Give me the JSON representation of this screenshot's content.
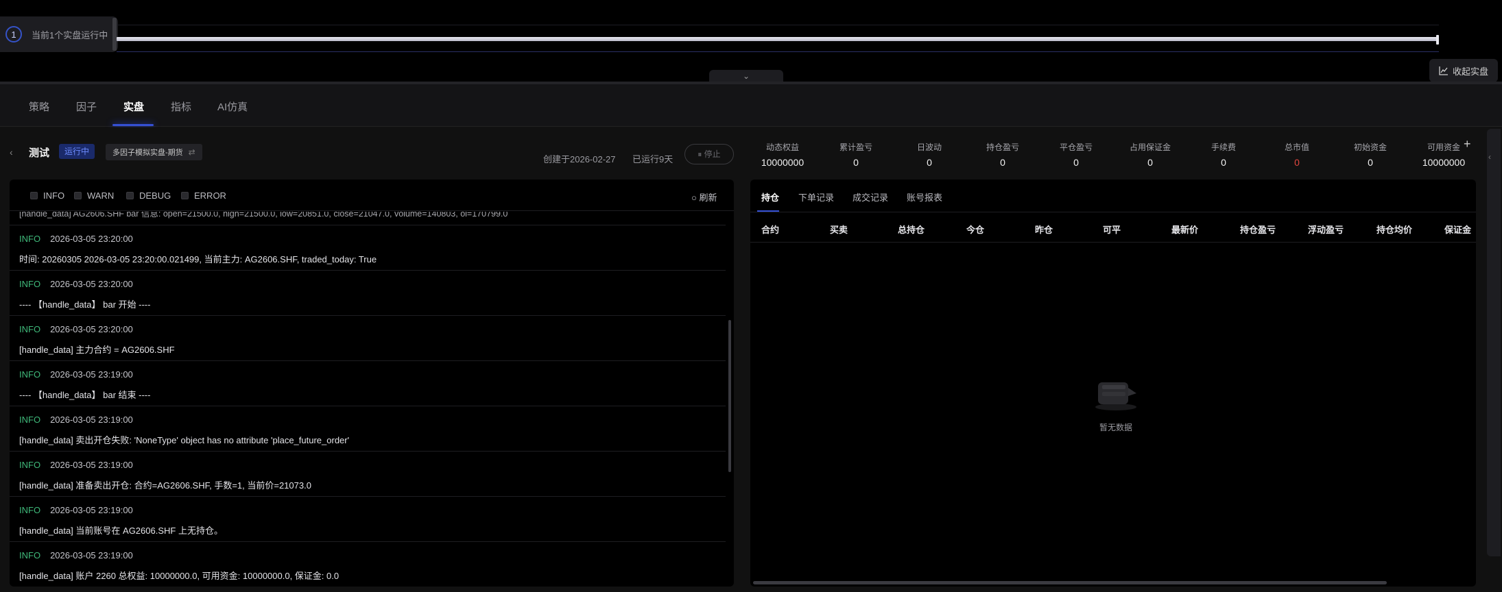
{
  "banner": {
    "run_count_badge": "1",
    "run_text": "当前1个实盘运行中",
    "fold_label": "收起实盘"
  },
  "main_tabs": [
    {
      "label": "策略"
    },
    {
      "label": "因子"
    },
    {
      "label": "实盘"
    },
    {
      "label": "指标"
    },
    {
      "label": "AI仿真"
    }
  ],
  "live": {
    "name": "测试",
    "status": "运行中",
    "type": "多因子模拟实盘-期货",
    "created": "创建于2026-02-27",
    "runtime": "已运行9天",
    "stop_label": "停止"
  },
  "log": {
    "filters": [
      "INFO",
      "WARN",
      "DEBUG",
      "ERROR"
    ],
    "refresh_label": "刷新",
    "partial_message": "[handle_data] AG2606.SHF bar 信息: open=21500.0, high=21500.0, low=20851.0, close=21047.0, volume=140803, oi=170799.0",
    "entries": [
      {
        "level": "INFO",
        "time": "2026-03-05 23:20:00",
        "message": "时间: 20260305 2026-03-05 23:20:00.021499, 当前主力: AG2606.SHF, traded_today: True"
      },
      {
        "level": "INFO",
        "time": "2026-03-05 23:20:00",
        "message": "---- 【handle_data】 bar 开始 ----"
      },
      {
        "level": "INFO",
        "time": "2026-03-05 23:20:00",
        "message": "[handle_data] 主力合约 = AG2606.SHF"
      },
      {
        "level": "INFO",
        "time": "2026-03-05 23:19:00",
        "message": "---- 【handle_data】 bar 结束 ----"
      },
      {
        "level": "INFO",
        "time": "2026-03-05 23:19:00",
        "message": "[handle_data] 卖出开仓失败: 'NoneType' object has no attribute 'place_future_order'"
      },
      {
        "level": "INFO",
        "time": "2026-03-05 23:19:00",
        "message": "[handle_data] 准备卖出开仓: 合约=AG2606.SHF, 手数=1, 当前价=21073.0"
      },
      {
        "level": "INFO",
        "time": "2026-03-05 23:19:00",
        "message": "[handle_data] 当前账号在 AG2606.SHF 上无持仓。"
      },
      {
        "level": "INFO",
        "time": "2026-03-05 23:19:00",
        "message": "[handle_data] 账户 2260 总权益: 10000000.0, 可用资金: 10000000.0, 保证金: 0.0"
      }
    ]
  },
  "metrics": [
    {
      "label": "动态权益",
      "value": "10000000"
    },
    {
      "label": "累计盈亏",
      "value": "0"
    },
    {
      "label": "日波动",
      "value": "0"
    },
    {
      "label": "持仓盈亏",
      "value": "0"
    },
    {
      "label": "平仓盈亏",
      "value": "0"
    },
    {
      "label": "占用保证金",
      "value": "0"
    },
    {
      "label": "手续费",
      "value": "0"
    },
    {
      "label": "总市值",
      "value": "0",
      "color": "#e0463f"
    },
    {
      "label": "初始资金",
      "value": "0"
    },
    {
      "label": "可用资金",
      "value": "10000000"
    }
  ],
  "positions": {
    "tabs": [
      "持仓",
      "下单记录",
      "成交记录",
      "账号报表"
    ],
    "columns": [
      "合约",
      "买卖",
      "总持仓",
      "今仓",
      "昨仓",
      "可平",
      "最新价",
      "持仓盈亏",
      "浮动盈亏",
      "持仓均价",
      "保证金"
    ],
    "empty_text": "暂无数据"
  },
  "colors": {
    "accent": "#3550d4",
    "info_level": "#3fb97a",
    "loss_red": "#e0463f",
    "panel_bg": "#000000",
    "page_bg": "#111111"
  }
}
